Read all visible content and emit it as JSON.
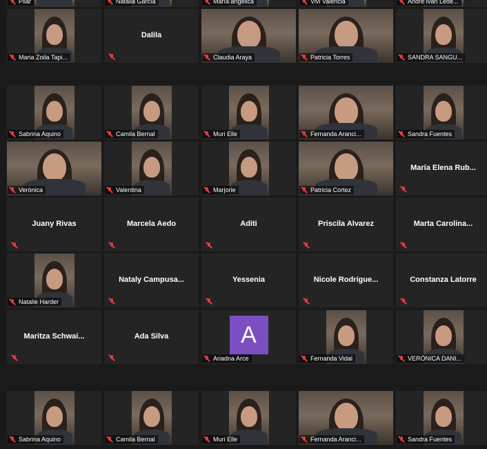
{
  "rows": [
    {
      "tiles": [
        {
          "name": "Pilar",
          "video": true,
          "label": true
        },
        {
          "name": "Natalia García",
          "video": true,
          "label": true
        },
        {
          "name": "María angélica",
          "video": true,
          "label": true
        },
        {
          "name": "Vivi Valencia",
          "video": true,
          "label": true
        },
        {
          "name": "Andre Ivan Lede...",
          "video": true,
          "label": true
        }
      ]
    },
    {
      "tiles": [
        {
          "name": "Maria Zoila Tapi...",
          "video": true,
          "label": true
        },
        {
          "name": "Dalila",
          "video": false
        },
        {
          "name": "Claudia Araya",
          "video": true,
          "wide": true,
          "label": true
        },
        {
          "name": "Patricia Torres",
          "video": true,
          "wide": true,
          "label": true
        },
        {
          "name": "SANDRA SANGU...",
          "video": true,
          "label": true
        }
      ]
    },
    {
      "tiles": [
        {
          "name": "Sabrina Aquino",
          "video": true,
          "label": true
        },
        {
          "name": "Camila Bernal",
          "video": true,
          "label": true
        },
        {
          "name": "Muri Elle",
          "video": true,
          "label": true
        },
        {
          "name": "Fernanda Aranci...",
          "video": true,
          "wide": true,
          "label": true
        },
        {
          "name": "Sandra Fuentes",
          "video": true,
          "label": true
        }
      ]
    },
    {
      "tiles": [
        {
          "name": "Verónica",
          "video": true,
          "wide": true,
          "label": true
        },
        {
          "name": "Valentina",
          "video": true,
          "label": true
        },
        {
          "name": "Marjorie",
          "video": true,
          "label": true
        },
        {
          "name": "Patricia Cortez",
          "video": true,
          "wide": true,
          "label": true
        },
        {
          "name": "María Elena Rub...",
          "video": false
        }
      ]
    },
    {
      "tiles": [
        {
          "name": "Juany Rivas",
          "video": false
        },
        {
          "name": "Marcela Aedo",
          "video": false
        },
        {
          "name": "Aditi",
          "video": false
        },
        {
          "name": "Priscila Alvarez",
          "video": false
        },
        {
          "name": "Marta Carolina...",
          "video": false
        }
      ]
    },
    {
      "tiles": [
        {
          "name": "Natalie Harder",
          "video": true,
          "label": true
        },
        {
          "name": "Nataly Campusa...",
          "video": false
        },
        {
          "name": "Yessenia",
          "video": false
        },
        {
          "name": "Nicole Rodrígue...",
          "video": false
        },
        {
          "name": "Constanza Latorre",
          "video": false
        }
      ]
    },
    {
      "tiles": [
        {
          "name": "Maritza Schwai...",
          "video": false
        },
        {
          "name": "Ada Silva",
          "video": false
        },
        {
          "name": "Ariadna Arce",
          "video": false,
          "avatar": "A",
          "label": true
        },
        {
          "name": "Fernanda Vidal",
          "video": true,
          "label": true
        },
        {
          "name": "VERÓNICA DANI...",
          "video": true,
          "label": true
        }
      ]
    },
    {
      "tiles": [
        {
          "name": "Sabrina Aquino",
          "video": true,
          "label": true
        },
        {
          "name": "Camila Bernal",
          "video": true,
          "label": true
        },
        {
          "name": "Muri Elle",
          "video": true,
          "label": true
        },
        {
          "name": "Fernanda Aranci...",
          "video": true,
          "wide": true,
          "label": true
        },
        {
          "name": "Sandra Fuentes",
          "video": true,
          "label": true
        }
      ]
    }
  ]
}
